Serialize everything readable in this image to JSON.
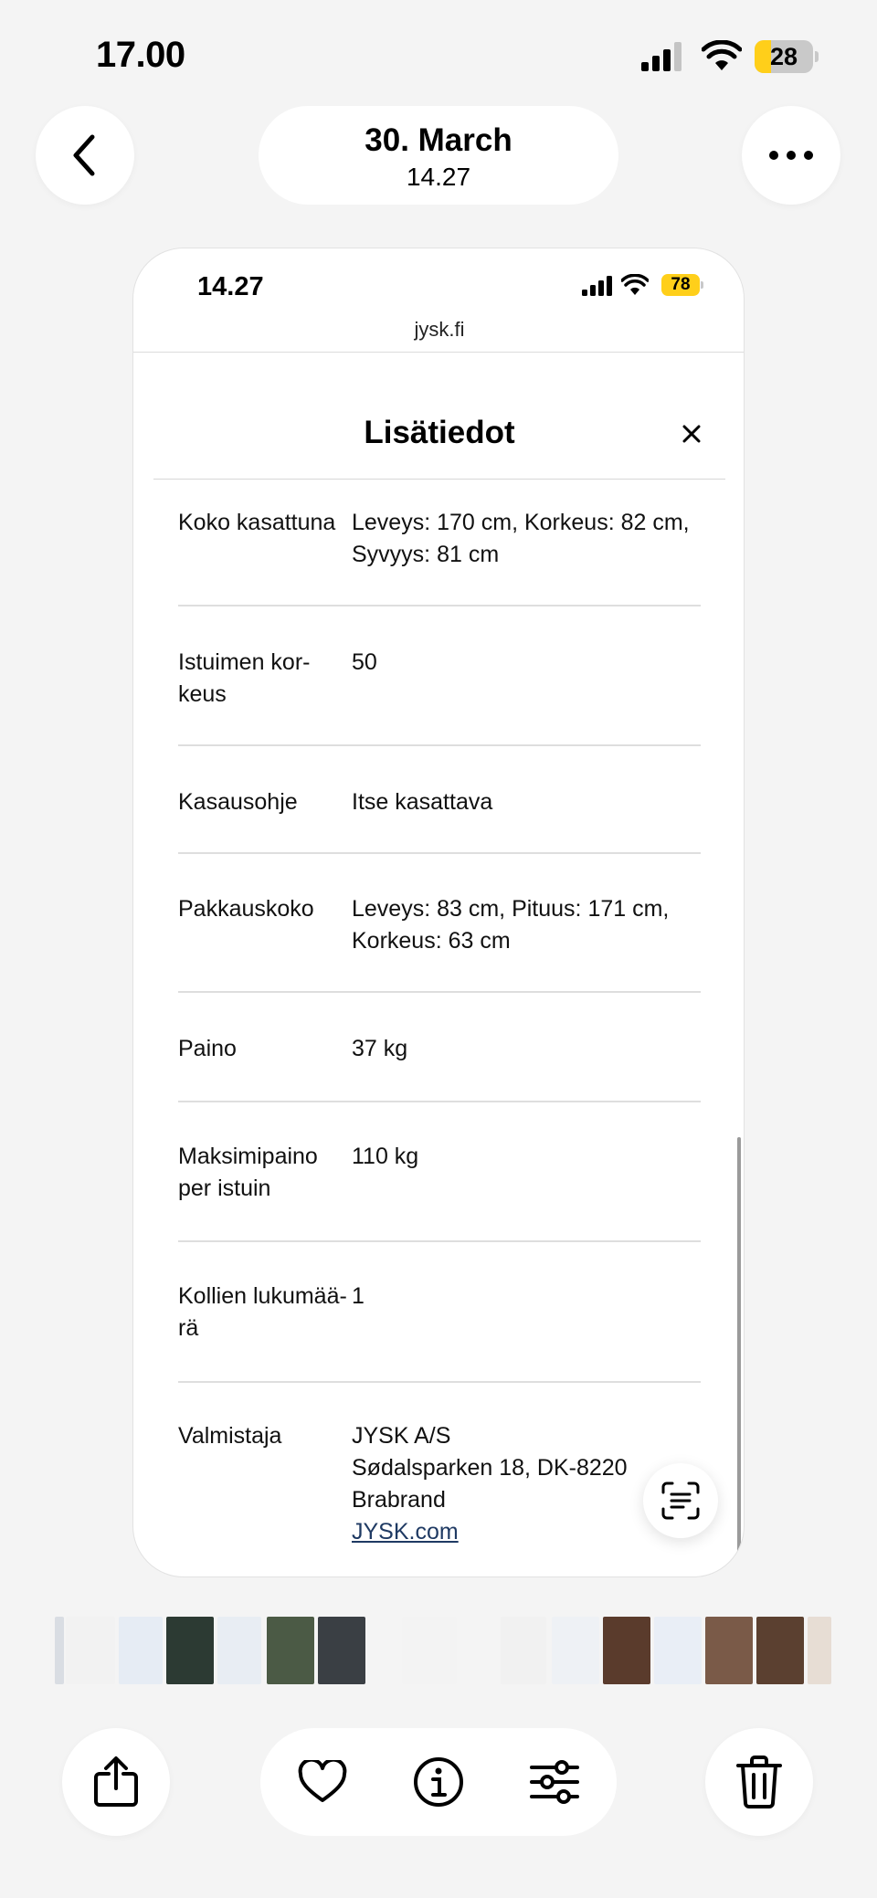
{
  "status_bar": {
    "time": "17.00",
    "battery": "28",
    "battery_level": 0.28
  },
  "nav": {
    "date": "30. March",
    "time": "14.27"
  },
  "screenshot": {
    "status_bar": {
      "time": "14.27",
      "battery": "78"
    },
    "url": "jysk.fi",
    "modal": {
      "title": "Lisätiedot",
      "rows": [
        {
          "label": "Koko kasattuna",
          "value_lines": [
            "Leveys: 170 cm, Korkeus: 82 cm,",
            "Syvyys: 81 cm"
          ]
        },
        {
          "label_lines": [
            "Istuimen kor-",
            "keus"
          ],
          "value": "50"
        },
        {
          "label": "Kasausohje",
          "value": "Itse kasattava"
        },
        {
          "label": "Pakkauskoko",
          "value_lines": [
            "Leveys: 83 cm, Pituus: 171 cm,",
            "Korkeus: 63 cm"
          ]
        },
        {
          "label": "Paino",
          "value": "37 kg"
        },
        {
          "label_lines": [
            "Maksimipaino",
            "per istuin"
          ],
          "value": "110 kg"
        },
        {
          "label_lines": [
            "Kollien lukumää-",
            "rä"
          ],
          "value": "1"
        },
        {
          "label": "Valmistaja",
          "value_lines": [
            "JYSK A/S",
            "Sødalsparken 18, DK-8220",
            "Brabrand"
          ],
          "link": "JYSK.com"
        }
      ]
    }
  },
  "icons": {
    "back": "chevron-left-icon",
    "more": "ellipsis-icon",
    "close": "close-icon",
    "scan": "live-text-icon",
    "share": "share-icon",
    "favorite": "heart-icon",
    "info": "info-icon",
    "adjust": "sliders-icon",
    "delete": "trash-icon"
  },
  "colors": {
    "battery_yellow": "#ffcf1a",
    "link": "#1f3a63"
  }
}
